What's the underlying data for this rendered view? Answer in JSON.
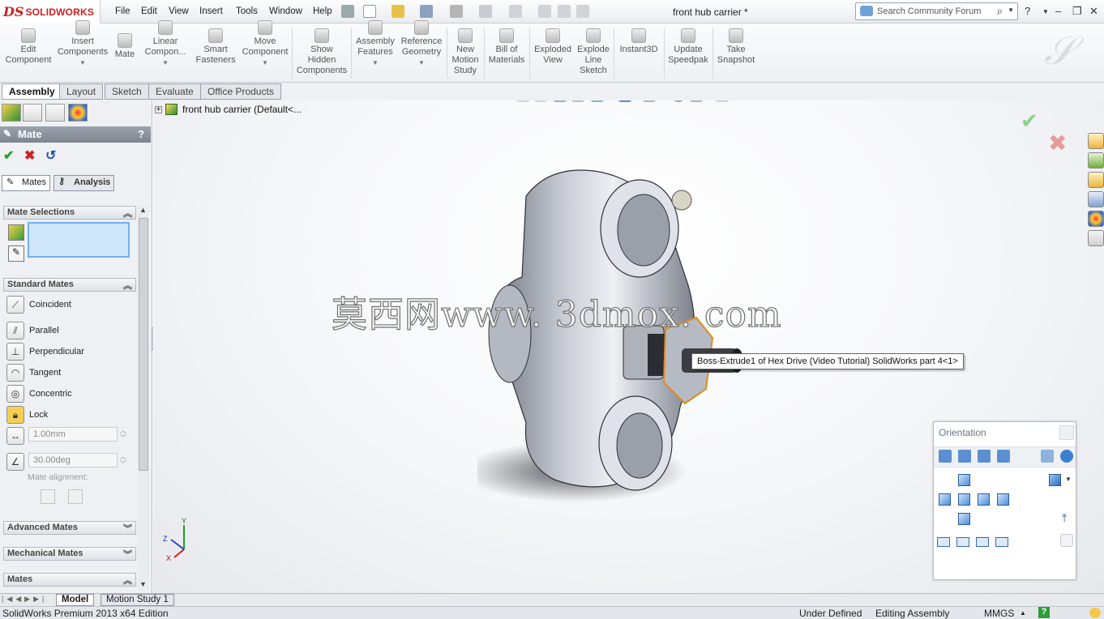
{
  "app": {
    "brand_mark": "DS",
    "brand_name": "SOLIDWORKS",
    "document_title": "front hub carrier *"
  },
  "menu": [
    "File",
    "Edit",
    "View",
    "Insert",
    "Tools",
    "Window",
    "Help"
  ],
  "search": {
    "placeholder": "Search Community Forum"
  },
  "command_manager": [
    {
      "label": "Edit\nComponent"
    },
    {
      "label": "Insert\nComponents"
    },
    {
      "label": "Mate"
    },
    {
      "label": "Linear\nCompon..."
    },
    {
      "label": "Smart\nFasteners"
    },
    {
      "label": "Move\nComponent"
    },
    {
      "label": "Show\nHidden\nComponents"
    },
    {
      "label": "Assembly\nFeatures"
    },
    {
      "label": "Reference\nGeometry"
    },
    {
      "label": "New\nMotion\nStudy"
    },
    {
      "label": "Bill of\nMaterials"
    },
    {
      "label": "Exploded\nView"
    },
    {
      "label": "Explode\nLine\nSketch"
    },
    {
      "label": "Instant3D"
    },
    {
      "label": "Update\nSpeedpak"
    },
    {
      "label": "Take\nSnapshot"
    }
  ],
  "tabs": [
    "Assembly",
    "Layout",
    "Sketch",
    "Evaluate",
    "Office Products"
  ],
  "property_manager": {
    "title": "Mate",
    "help": "?",
    "subtabs": [
      "Mates",
      "Analysis"
    ],
    "groups": {
      "mate_selections": "Mate Selections",
      "standard_mates": "Standard Mates",
      "advanced_mates": "Advanced Mates",
      "mechanical_mates": "Mechanical Mates",
      "mates": "Mates"
    },
    "standard_mates": [
      "Coincident",
      "Parallel",
      "Perpendicular",
      "Tangent",
      "Concentric",
      "Lock"
    ],
    "distance_value": "1.00mm",
    "angle_value": "30.00deg",
    "mate_alignment_label": "Mate alignment:"
  },
  "tree": {
    "root": "front hub carrier  (Default<..."
  },
  "viewport": {
    "watermark": "莫西网www. 3dmox. com",
    "tooltip": "Boss-Extrude1 of Hex Drive (Video Tutorial) SolidWorks part 4<1>",
    "axis_labels": {
      "y": "Y",
      "z": "Z",
      "x": "X"
    }
  },
  "orientation": {
    "title": "Orientation"
  },
  "bottom_tabs": [
    "Model",
    "Motion Study 1"
  ],
  "status": {
    "edition": "SolidWorks Premium 2013 x64 Edition",
    "definition": "Under Defined",
    "editing": "Editing Assembly",
    "units": "MMGS",
    "units_arrow": "▲",
    "help": "?"
  },
  "colors": {
    "accent_red": "#d21e1e",
    "selection_orange": "#e08a1e",
    "ok_green": "#2a9d2a",
    "cancel_red": "#cc2222"
  }
}
